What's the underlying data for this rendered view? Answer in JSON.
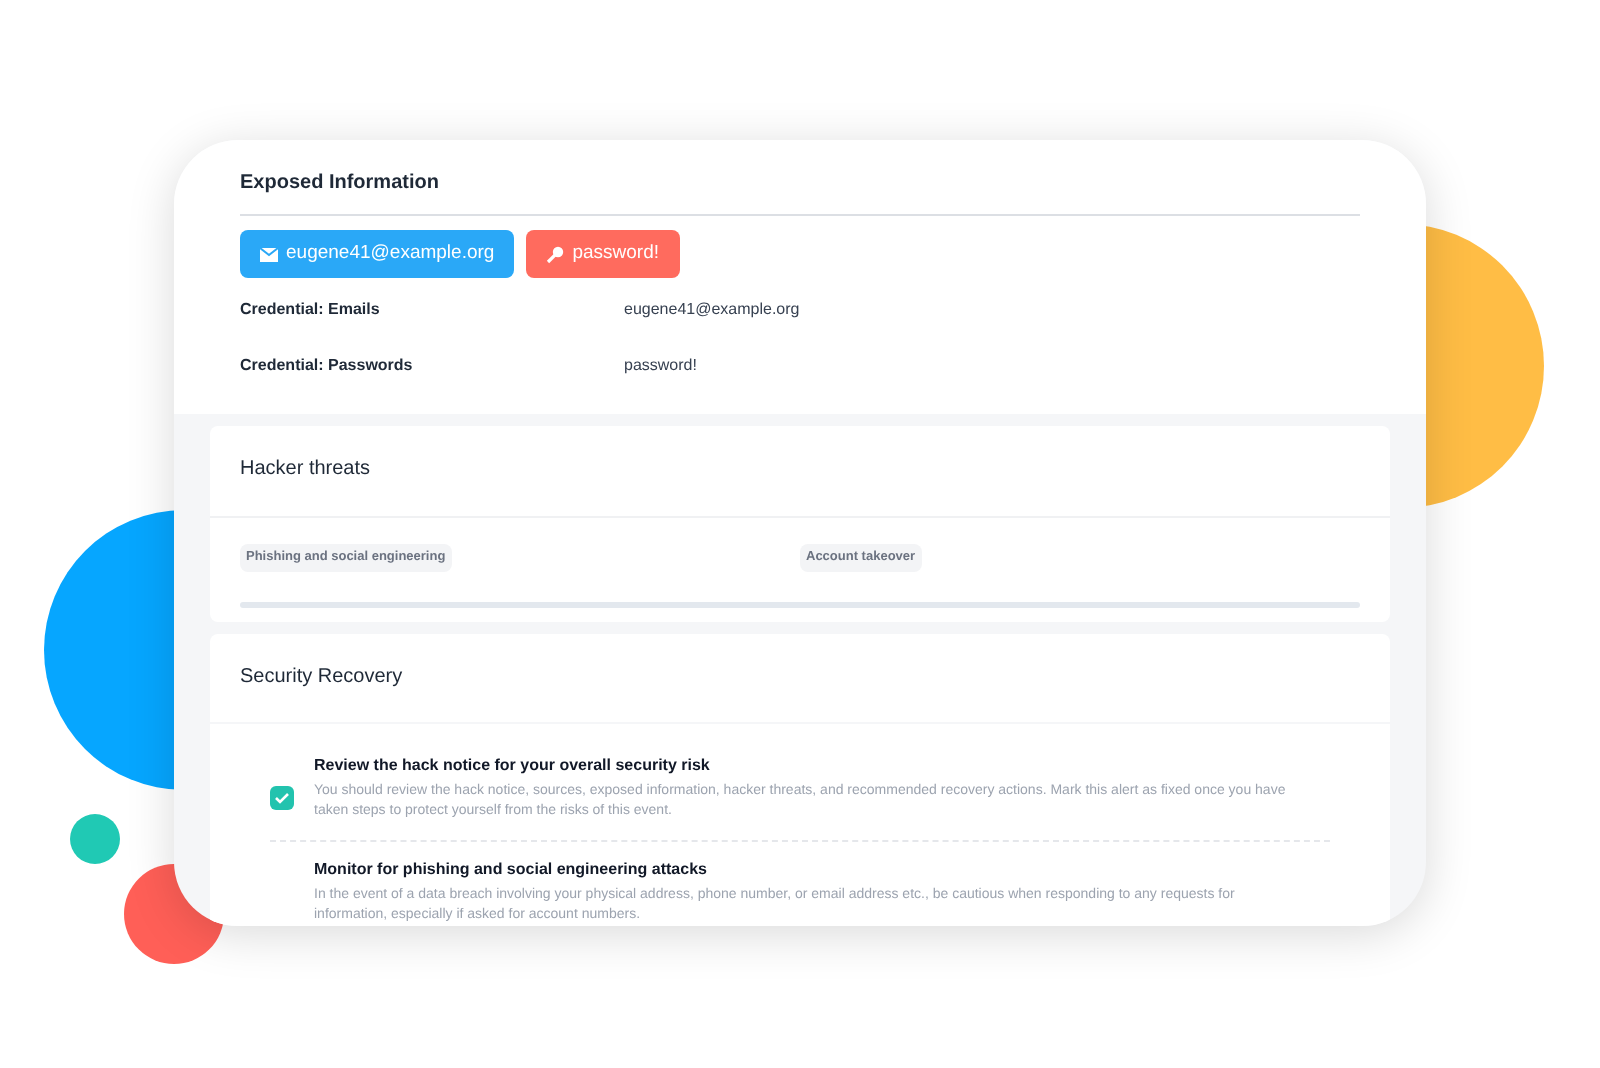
{
  "exposed_information": {
    "title": "Exposed Information",
    "chips": [
      {
        "kind": "email",
        "label": "eugene41@example.org"
      },
      {
        "kind": "password",
        "label": "password!"
      }
    ],
    "rows": [
      {
        "label": "Credential: Emails",
        "value": "eugene41@example.org"
      },
      {
        "label": "Credential: Passwords",
        "value": "password!"
      }
    ]
  },
  "hacker_threats": {
    "title": "Hacker threats",
    "tags": [
      "Phishing and social engineering",
      "Account takeover"
    ]
  },
  "security_recovery": {
    "title": "Security Recovery",
    "items": [
      {
        "title": "Review the hack notice for your overall security risk",
        "text": "You should review the hack notice, sources, exposed information, hacker threats, and recommended recovery actions. Mark this alert as fixed once you have taken steps to protect yourself from the risks of this event.",
        "checked": true
      },
      {
        "title": "Monitor for phishing and social engineering attacks",
        "text": "In the event of a data breach involving your physical address, phone number, or email address etc., be cautious when responding to any requests for information, especially if asked for account numbers.",
        "checked": false
      }
    ]
  }
}
